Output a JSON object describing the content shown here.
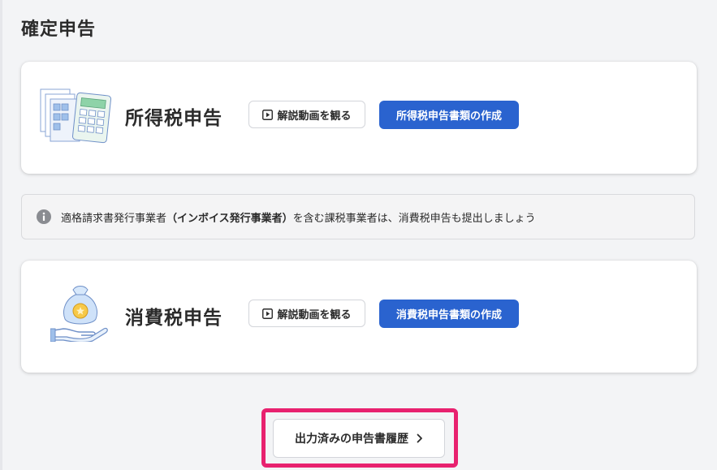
{
  "page": {
    "title": "確定申告"
  },
  "income_tax": {
    "title": "所得税申告",
    "video_label": "解説動画を観る",
    "create_label": "所得税申告書類の作成",
    "illustration": "documents-calculator-illustration"
  },
  "notice": {
    "icon": "info-icon",
    "text_before": "適格請求書発行事業者",
    "text_strong": "（インボイス発行事業者）",
    "text_after": "を含む課税事業者は、消費税申告も提出しましょう"
  },
  "consumption_tax": {
    "title": "消費税申告",
    "video_label": "解説動画を観る",
    "create_label": "消費税申告書類の作成",
    "illustration": "money-bag-hand-illustration"
  },
  "history": {
    "label": "出力済みの申告書履歴",
    "icon": "chevron-right-icon"
  },
  "colors": {
    "primary": "#2a63cf",
    "highlight": "#e8216f",
    "background": "#f3f4f6"
  }
}
